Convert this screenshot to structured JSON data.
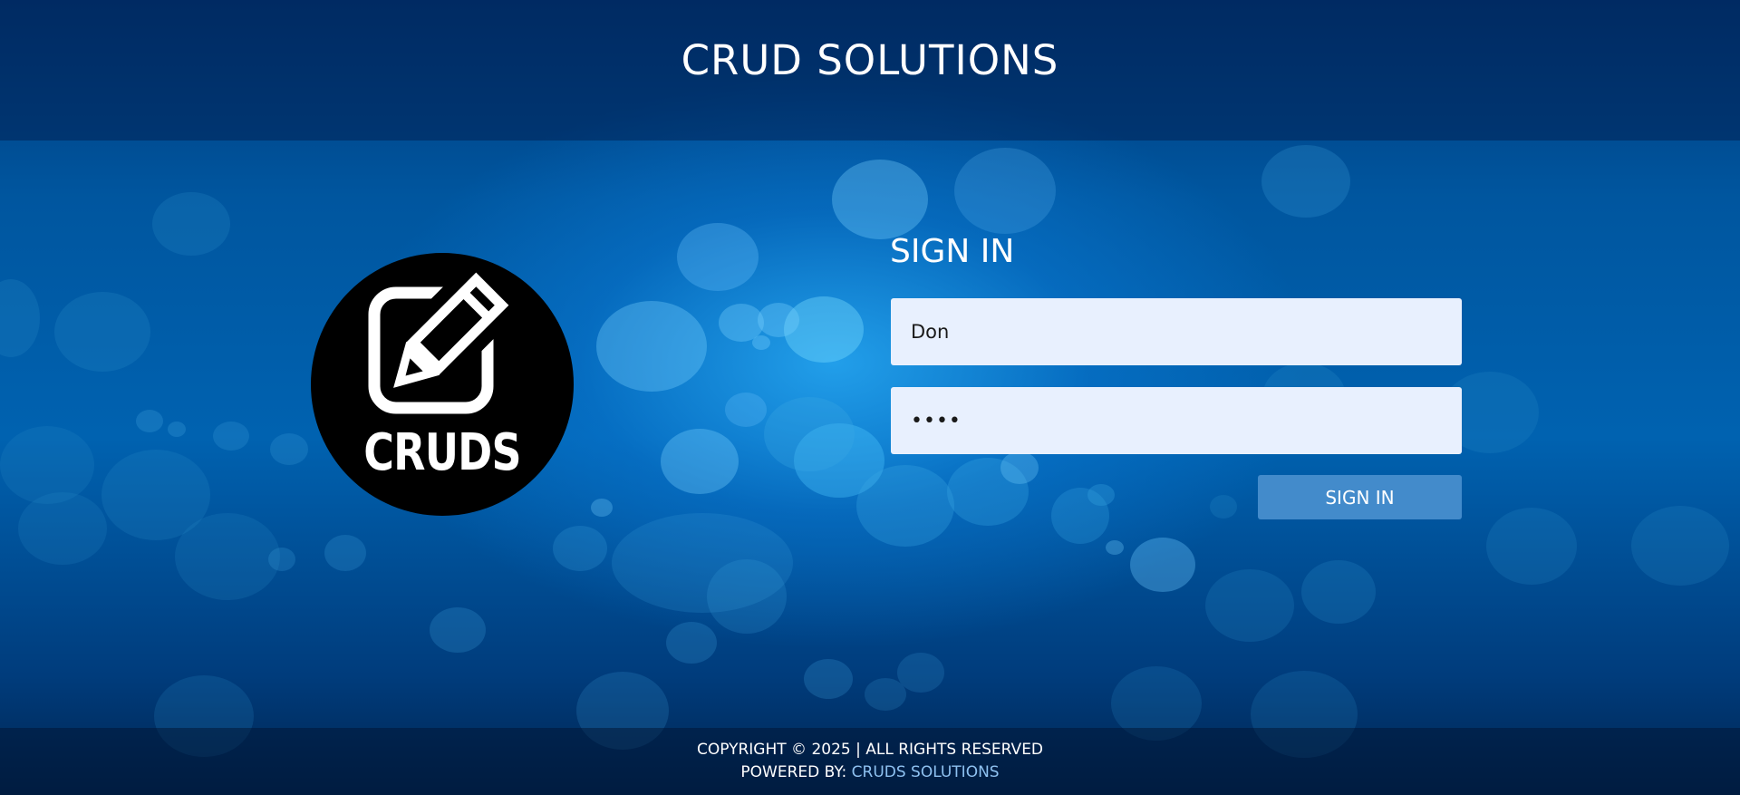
{
  "header": {
    "title": "CRUD SOLUTIONS"
  },
  "logo": {
    "text": "CRUDS",
    "icon": "edit-icon"
  },
  "signin": {
    "heading": "SIGN IN",
    "username_value": "Don",
    "password_value": "test",
    "button_label": "SIGN IN"
  },
  "footer": {
    "copyright": "COPYRIGHT © 2025 | ALL RIGHTS RESERVED",
    "powered_label": "POWERED BY:",
    "powered_link": "CRUDS SOLUTIONS"
  },
  "colors": {
    "button": "#438bcb",
    "input_background": "#e8f0fe",
    "link": "#8ec1f0"
  }
}
